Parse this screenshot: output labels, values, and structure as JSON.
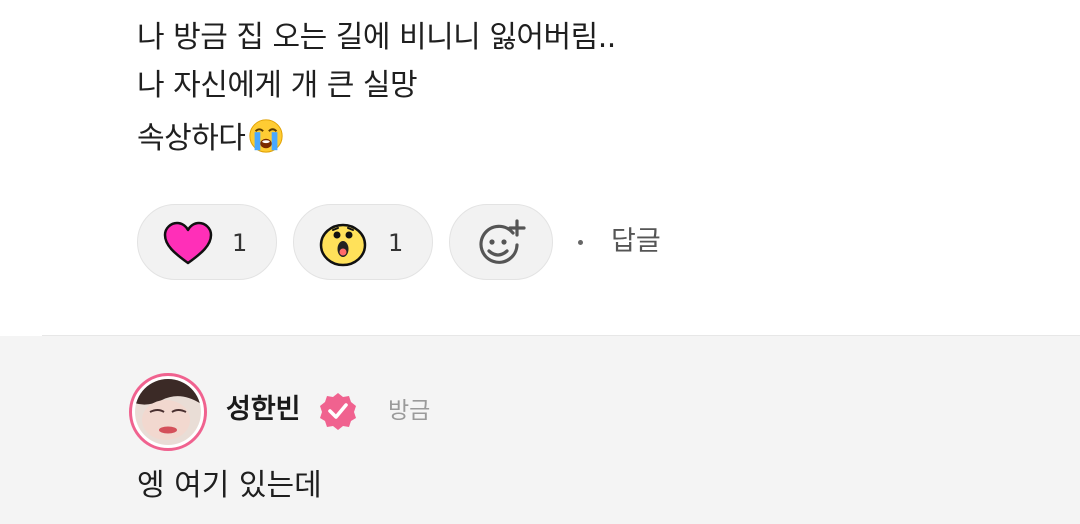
{
  "post": {
    "lines": [
      "나 방금 집 오는 길에 비니니 잃어버림..",
      "나 자신에게 개 큰 실망",
      "속상하다"
    ],
    "trailing_emoji": "loudly-crying-face"
  },
  "reactions": [
    {
      "icon": "heart",
      "color": "#ff2fb8",
      "count": "1"
    },
    {
      "icon": "surprised-face",
      "color": "#ffe15a",
      "count": "1"
    }
  ],
  "add_reaction_icon": "add-reaction-smiley",
  "reply_link_label": "답글",
  "reply": {
    "author": "성한빈",
    "verified": true,
    "time": "방금",
    "text": "엥 여기 있는데"
  },
  "colors": {
    "accent_pink": "#f0628f",
    "reply_bg": "#f4f4f4",
    "pill_bg": "#f2f2f2"
  }
}
